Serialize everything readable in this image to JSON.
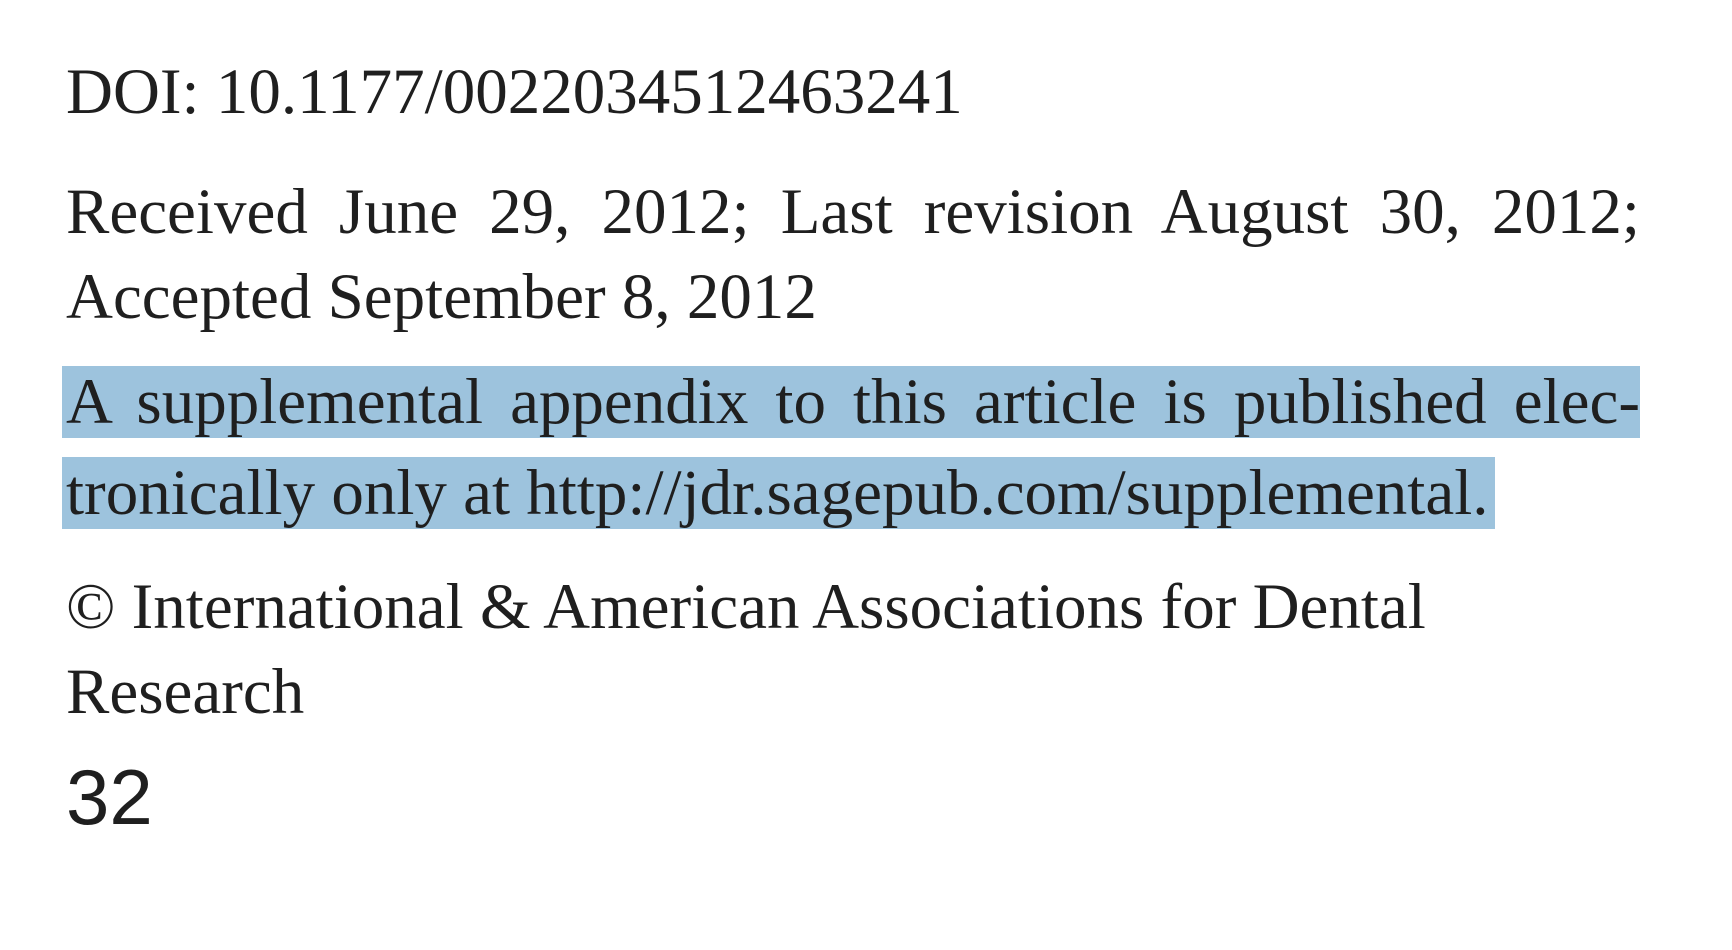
{
  "doi": "DOI: 10.1177/0022034512463241",
  "received": {
    "line1": "Received June 29, 2012; Last revision August 30, 2012;",
    "line2": "Accepted September 8, 2012"
  },
  "supplement": {
    "line1": "A supplemental appendix to this article is published elec-",
    "line2": "tronically only at http://jdr.sagepub.com/supplemental."
  },
  "copyright": "© International & American Associations for Dental Research",
  "page_number": "32",
  "colors": {
    "highlight": "#9dc3dd",
    "text": "#1f1f1f",
    "background": "#ffffff"
  }
}
